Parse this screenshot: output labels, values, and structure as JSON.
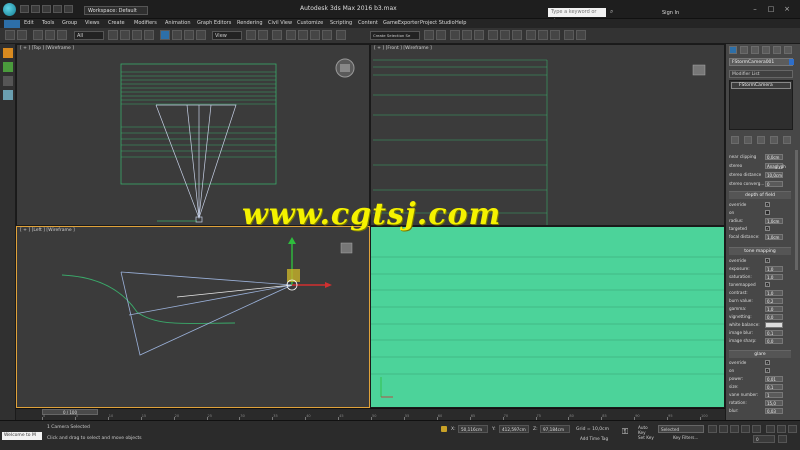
{
  "titlebar": {
    "workspace": "Workspace: Default",
    "app_title": "Autodesk 3ds Max 2016    b3.max",
    "search_placeholder": "Type a keyword or phrase",
    "sign_in": "Sign In"
  },
  "menubar": [
    "Edit",
    "Tools",
    "Group",
    "Views",
    "Create",
    "Modifiers",
    "Animation",
    "Graph Editors",
    "Rendering",
    "Civil View",
    "Customize",
    "Scripting",
    "Content",
    "GameExporter",
    "Project Studio",
    "Help"
  ],
  "toolbar": {
    "selection_filter": "All",
    "reference_coord": "View",
    "selection_set": "Create Selection Se"
  },
  "viewports": {
    "top": "[ + ] [Top ] [Wireframe ]",
    "front": "[ + ] [Front ] [Wireframe ]",
    "left": "[ + ] [Left ] [Wireframe ]",
    "camera_bg": "#4cd39a"
  },
  "command_panel": {
    "object_name": "FStormCamera001",
    "modifier_list": "Modifier List",
    "stack_item": "FStormCamera",
    "params": [
      {
        "label": "near clipping",
        "value": "0,0cm"
      },
      {
        "label": "stereo",
        "value": "Anaglyph"
      },
      {
        "label": "stereo distance",
        "value": "10,0cm"
      },
      {
        "label": "stereo converg...",
        "value": "0"
      }
    ],
    "dof_header": "depth of field",
    "dof": [
      {
        "label": "override",
        "check": "✓"
      },
      {
        "label": "on",
        "check": ""
      },
      {
        "label": "radius:",
        "value": "1,0cm"
      },
      {
        "label": "targeted",
        "check": "✓"
      },
      {
        "label": "focal distance:",
        "value": "1,0cm"
      }
    ],
    "tone_header": "tone mapping",
    "tone": [
      {
        "label": "override",
        "check": "✓"
      },
      {
        "label": "exposure:",
        "value": "1,0"
      },
      {
        "label": "saturation:",
        "value": "1,0"
      },
      {
        "label": "tonemapped",
        "check": "✓"
      },
      {
        "label": "contrast:",
        "value": "1,0"
      },
      {
        "label": "burn value:",
        "value": "0,2"
      },
      {
        "label": "gamma:",
        "value": "1,0"
      },
      {
        "label": "vignetting:",
        "value": "0,0"
      },
      {
        "label": "white balance:",
        "value": ""
      },
      {
        "label": "image blur:",
        "value": "0,1"
      },
      {
        "label": "image sharp:",
        "value": "0,0"
      }
    ],
    "glare_header": "glare",
    "glare": [
      {
        "label": "override",
        "check": "✓"
      },
      {
        "label": "on",
        "check": "✓"
      },
      {
        "label": "power:",
        "value": "0,01"
      },
      {
        "label": "size:",
        "value": "0,1"
      },
      {
        "label": "vane number:",
        "value": "1"
      },
      {
        "label": "rotation:",
        "value": "15,0"
      },
      {
        "label": "blur:",
        "value": "0,03"
      }
    ]
  },
  "timeline": {
    "slider": "0 / 100",
    "ticks": [
      "0",
      "5",
      "10",
      "15",
      "20",
      "25",
      "30",
      "35",
      "40",
      "45",
      "50",
      "55",
      "60",
      "65",
      "70",
      "75",
      "80",
      "85",
      "90",
      "95",
      "100"
    ]
  },
  "statusbar": {
    "maxscript": "Welcome to M",
    "status": "1 Camera Selected",
    "prompt": "Click and drag to select and move objects",
    "x_label": "X:",
    "x": "50,116cm",
    "y_label": "Y:",
    "y": "412,597cm",
    "z_label": "Z:",
    "z": "97,184cm",
    "grid": "Grid = 10,0cm",
    "auto_key": "Auto Key",
    "selected": "Selected",
    "set_key": "Set Key",
    "key_filters": "Key Filters...",
    "add_time_tag": "Add Time Tag",
    "frame": "0"
  },
  "watermark": "www.cgtsj.com"
}
